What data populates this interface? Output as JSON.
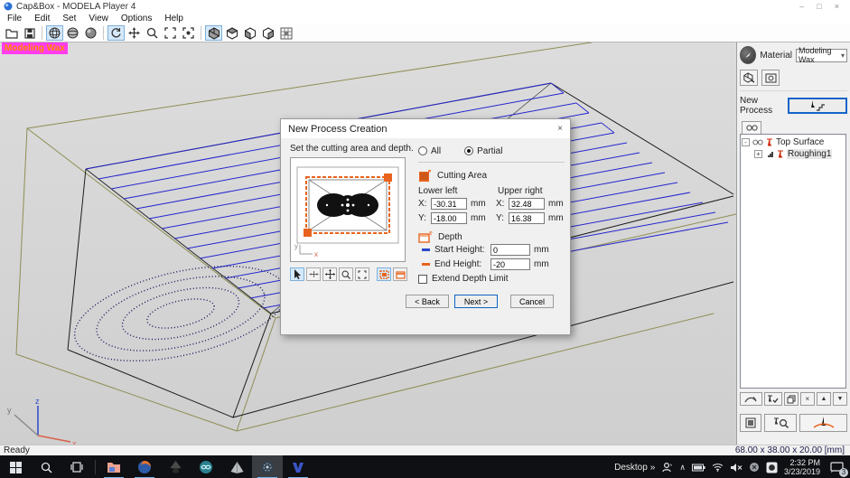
{
  "window": {
    "title": "Cap&Box - MODELA Player 4"
  },
  "menu": {
    "items": [
      "File",
      "Edit",
      "Set",
      "View",
      "Options",
      "Help"
    ]
  },
  "viewport": {
    "overlay_label": "Modeling Wax"
  },
  "dialog": {
    "title": "New Process Creation",
    "instruction": "Set the cutting area and depth.",
    "radios": {
      "all": "All",
      "partial": "Partial"
    },
    "cutting_area": {
      "label": "Cutting Area",
      "lower_left_label": "Lower left",
      "upper_right_label": "Upper right",
      "x_label": "X:",
      "y_label": "Y:",
      "unit": "mm",
      "lower_left": {
        "x": "-30.31",
        "y": "-18.00"
      },
      "upper_right": {
        "x": "32.48",
        "y": "16.38"
      }
    },
    "depth": {
      "label": "Depth",
      "start_label": "Start Height:",
      "start_value": "0",
      "end_label": "End Height:",
      "end_value": "-20",
      "unit": "mm",
      "extend_label": "Extend Depth Limit"
    },
    "buttons": {
      "back": "< Back",
      "next": "Next >",
      "cancel": "Cancel"
    }
  },
  "right_panel": {
    "material_label": "Material",
    "material_value": "Modeling Wax",
    "new_process_label": "New Process",
    "tree": {
      "items": [
        {
          "label": "Top Surface"
        },
        {
          "label": "Roughing1"
        }
      ]
    },
    "dimensions": "68.00 x 38.00 x 20.00 [mm]"
  },
  "statusbar": {
    "ready": "Ready"
  },
  "taskbar": {
    "desktop_label": "Desktop",
    "chevrons": "»",
    "time": "2:32 PM",
    "date": "3/23/2019",
    "notification_count": "3"
  },
  "icons": {
    "minimize": "–",
    "maximize": "□",
    "close": "×",
    "dropdown_arrow": "▾",
    "caret_up": "∧",
    "tree_collapse": "-",
    "tree_expand": "+",
    "up_arrow": "▲",
    "down_arrow": "▼",
    "delete_x": "×"
  },
  "colors": {
    "accent_orange": "#e8641e",
    "toolpath_blue": "#2525cf",
    "overlay_magenta": "#ff3dee",
    "focus_blue": "#1464c8"
  }
}
